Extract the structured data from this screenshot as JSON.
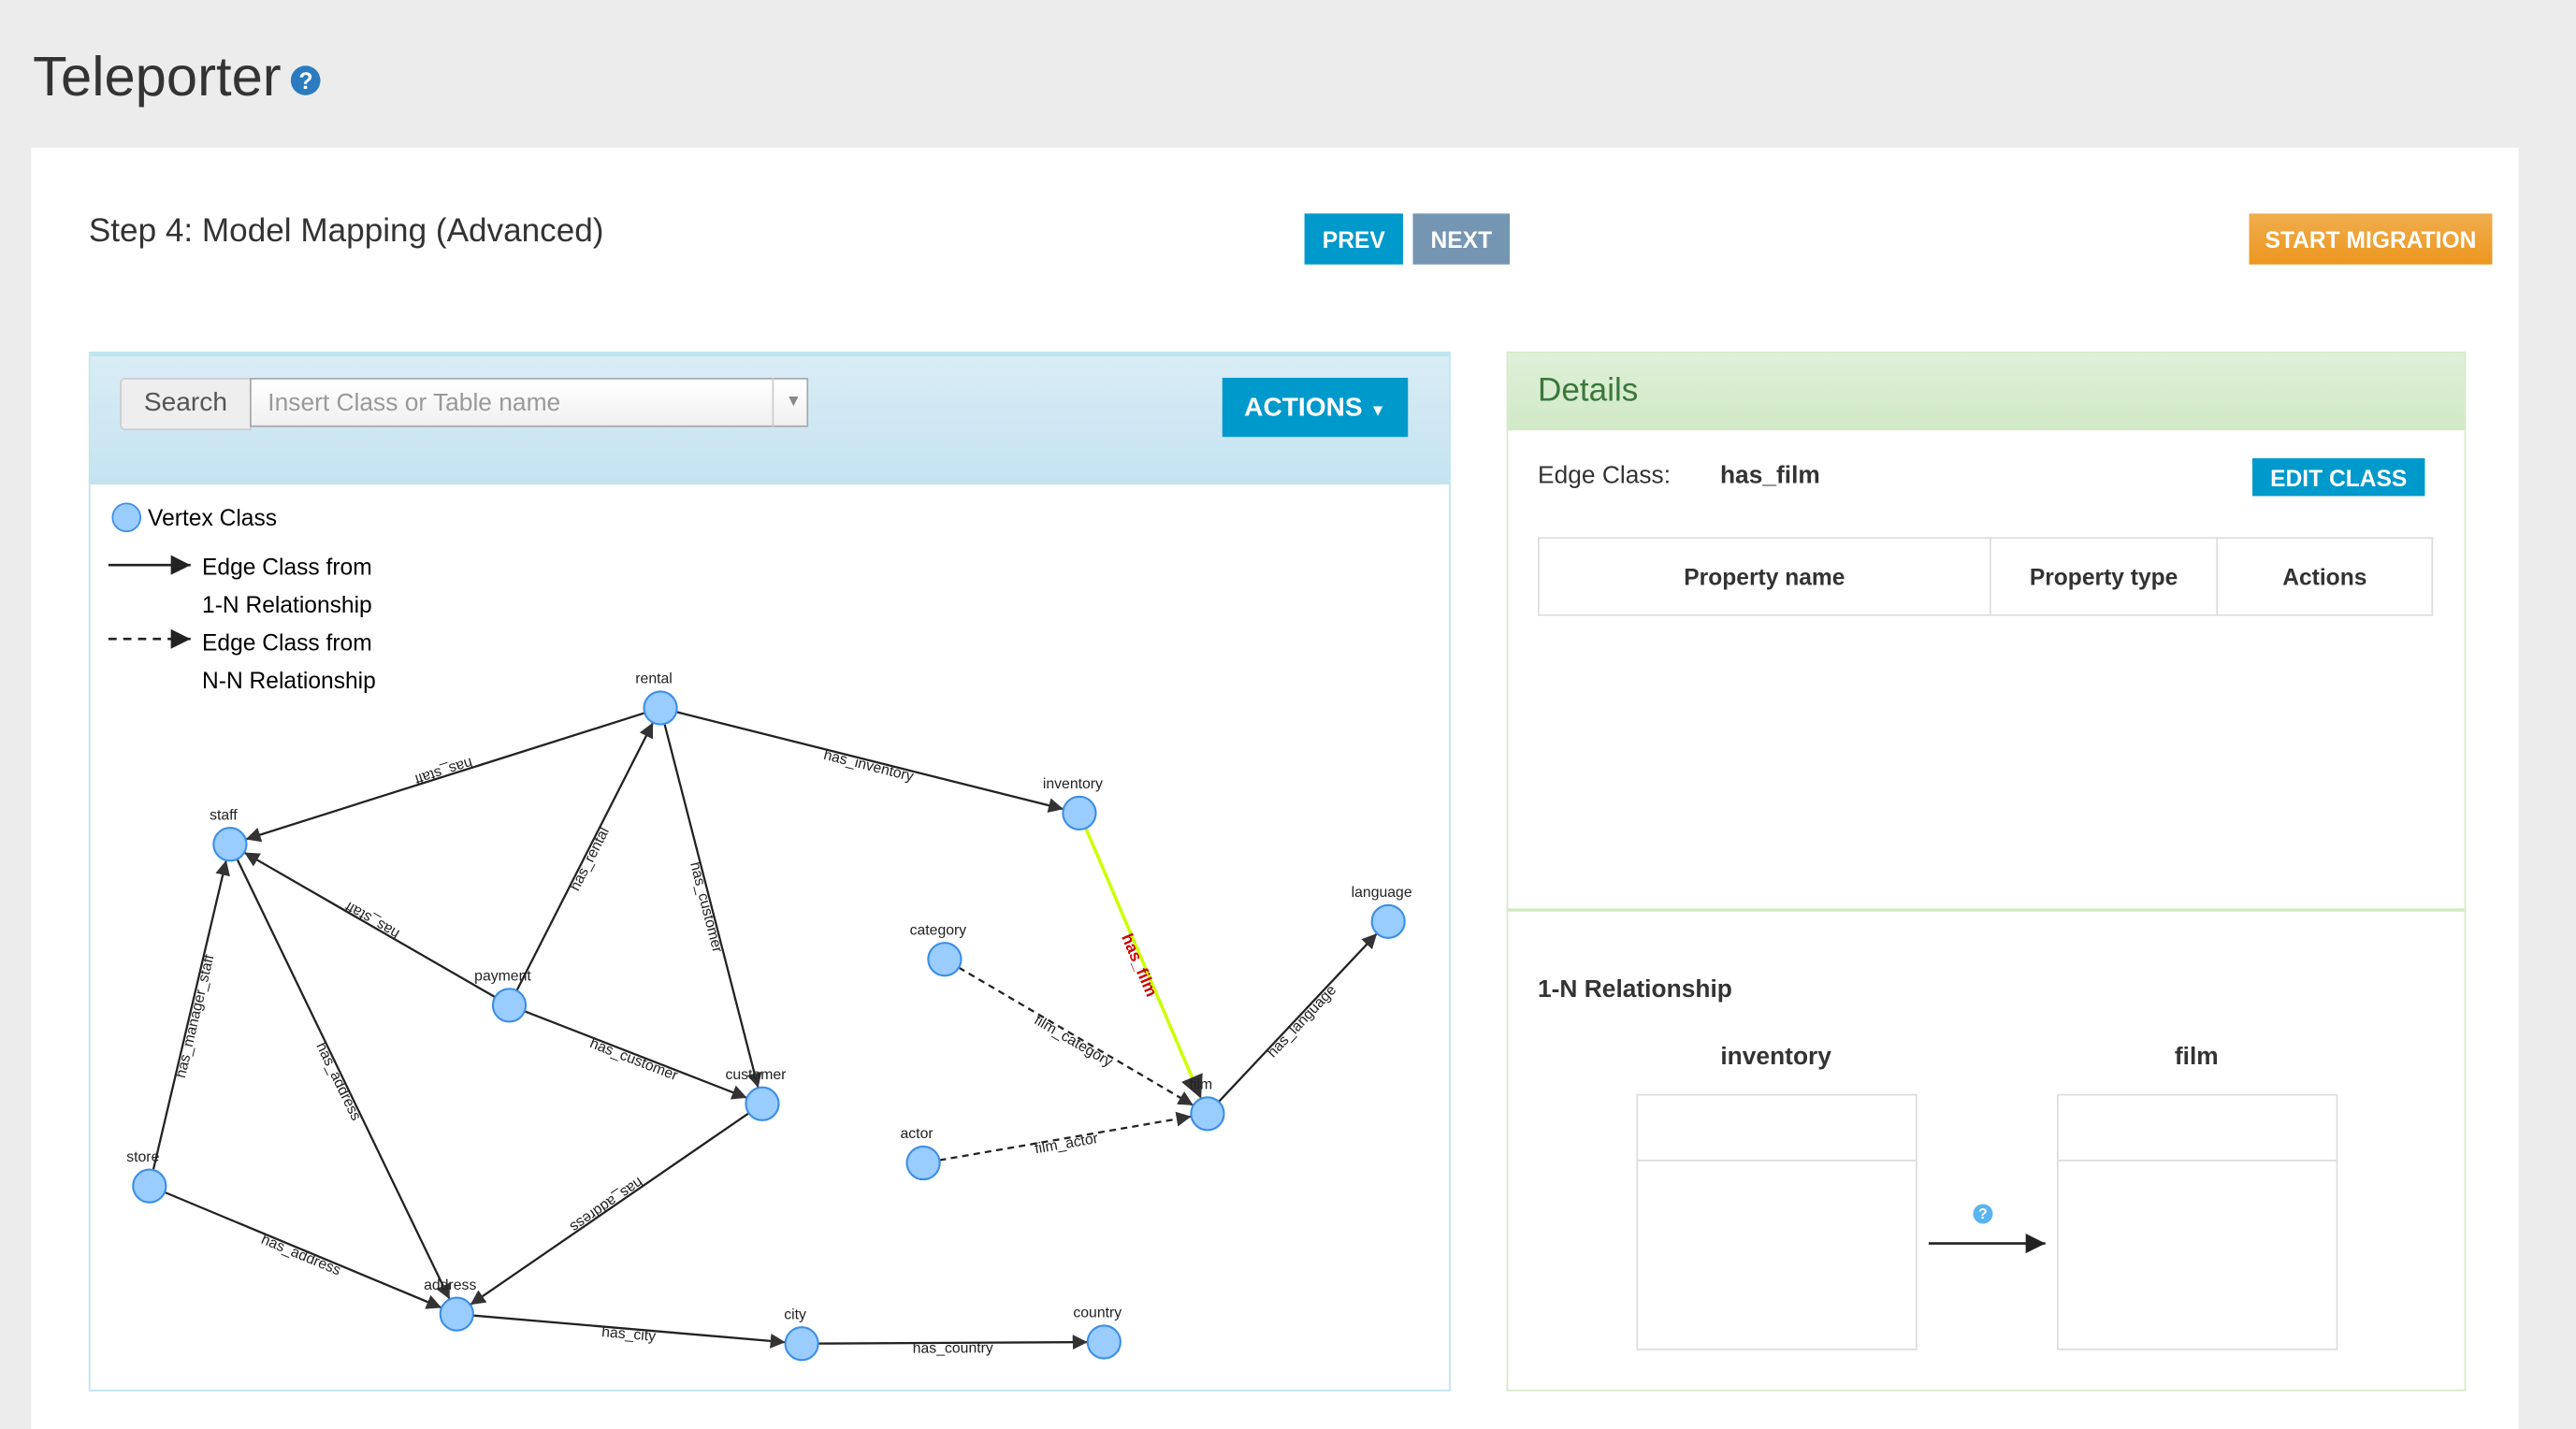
{
  "header": {
    "title": "Teleporter",
    "help_icon": "question-circle-icon"
  },
  "step": {
    "title": "Step 4: Model Mapping (Advanced)",
    "prev_label": "PREV",
    "next_label": "NEXT",
    "start_label": "START MIGRATION"
  },
  "left_panel": {
    "search_label": "Search",
    "search_placeholder": "Insert Class or Table name",
    "search_value": "",
    "actions_label": "ACTIONS",
    "legend": {
      "vertex": "Vertex Class",
      "edge_1n_line1": "Edge Class from",
      "edge_1n_line2": "1-N Relationship",
      "edge_nn_line1": "Edge Class from",
      "edge_nn_line2": "N-N Relationship"
    }
  },
  "graph": {
    "nodes": [
      "rental",
      "inventory",
      "staff",
      "language",
      "category",
      "payment",
      "customer",
      "film",
      "actor",
      "store",
      "address",
      "city",
      "country"
    ],
    "edges": [
      {
        "from": "rental",
        "to": "staff",
        "label": "has_staff",
        "type": "1-N"
      },
      {
        "from": "rental",
        "to": "inventory",
        "label": "has_inventory",
        "type": "1-N"
      },
      {
        "from": "payment",
        "to": "rental",
        "label": "has_rental",
        "type": "1-N"
      },
      {
        "from": "rental",
        "to": "customer",
        "label": "has_customer",
        "type": "1-N"
      },
      {
        "from": "payment",
        "to": "staff",
        "label": "has_staff",
        "type": "1-N"
      },
      {
        "from": "payment",
        "to": "customer",
        "label": "has_customer",
        "type": "1-N"
      },
      {
        "from": "staff",
        "to": "address",
        "label": "has_address",
        "type": "1-N"
      },
      {
        "from": "store",
        "to": "staff",
        "label": "has_manager_staff",
        "type": "1-N"
      },
      {
        "from": "store",
        "to": "address",
        "label": "has_address",
        "type": "1-N"
      },
      {
        "from": "customer",
        "to": "address",
        "label": "has_address",
        "type": "1-N"
      },
      {
        "from": "address",
        "to": "city",
        "label": "has_city",
        "type": "1-N"
      },
      {
        "from": "city",
        "to": "country",
        "label": "has_country",
        "type": "1-N"
      },
      {
        "from": "inventory",
        "to": "film",
        "label": "has_film",
        "type": "1-N",
        "selected": true
      },
      {
        "from": "category",
        "to": "film",
        "label": "film_category",
        "type": "N-N"
      },
      {
        "from": "actor",
        "to": "film",
        "label": "film_actor",
        "type": "N-N"
      },
      {
        "from": "film",
        "to": "language",
        "label": "has_language",
        "type": "1-N"
      }
    ],
    "colors": {
      "node_fill": "#99ccff",
      "node_stroke": "#3a8ee6",
      "selected_edge": "#ccff00",
      "selected_label": "#cc0000"
    }
  },
  "details": {
    "title": "Details",
    "edge_class_label": "Edge Class:",
    "edge_class_value": "has_film",
    "edit_label": "EDIT CLASS",
    "columns": [
      "Property name",
      "Property type",
      "Actions"
    ],
    "relationship_title": "1-N Relationship",
    "from_table": "inventory",
    "to_table": "film"
  }
}
